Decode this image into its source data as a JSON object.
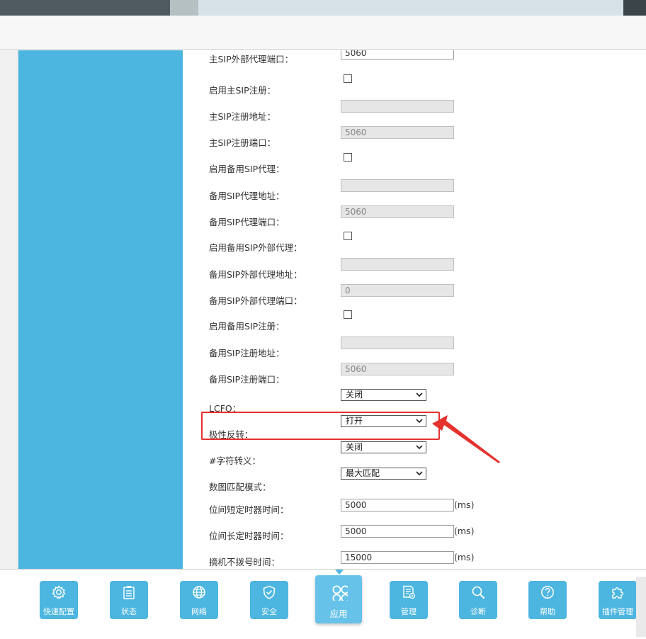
{
  "form": {
    "rows": [
      {
        "label": "主SIP外部代理端口：",
        "type": "input",
        "value": "5060"
      },
      {
        "label": "启用主SIP注册：",
        "type": "checkbox",
        "checked": false
      },
      {
        "label": "主SIP注册地址：",
        "type": "input-disabled",
        "value": ""
      },
      {
        "label": "主SIP注册端口：",
        "type": "input-disabled",
        "value": "5060"
      },
      {
        "label": "启用备用SIP代理：",
        "type": "checkbox",
        "checked": false
      },
      {
        "label": "备用SIP代理地址：",
        "type": "input-disabled",
        "value": ""
      },
      {
        "label": "备用SIP代理端口：",
        "type": "input-disabled",
        "value": "5060"
      },
      {
        "label": "启用备用SIP外部代理：",
        "type": "checkbox",
        "checked": false
      },
      {
        "label": "备用SIP外部代理地址：",
        "type": "input-disabled",
        "value": ""
      },
      {
        "label": "备用SIP外部代理端口：",
        "type": "input-disabled",
        "value": "0"
      },
      {
        "label": "启用备用SIP注册：",
        "type": "checkbox",
        "checked": false
      },
      {
        "label": "备用SIP注册地址：",
        "type": "input-disabled",
        "value": ""
      },
      {
        "label": "备用SIP注册端口：",
        "type": "input-disabled",
        "value": "5060"
      },
      {
        "label": "LCFO：",
        "type": "select",
        "value": "关闭"
      },
      {
        "label": "极性反转：",
        "type": "select",
        "value": "打开"
      },
      {
        "label": "#字符转义：",
        "type": "select",
        "value": "关闭"
      },
      {
        "label": "数图匹配模式：",
        "type": "select",
        "value": "最大匹配"
      },
      {
        "label": "位间短定时器时间：",
        "type": "input-unit",
        "value": "5000",
        "unit": "(ms)"
      },
      {
        "label": "位间长定时器时间：",
        "type": "input-unit",
        "value": "5000",
        "unit": "(ms)"
      },
      {
        "label": "摘机不拨号时间：",
        "type": "input-unit",
        "value": "15000",
        "unit": "(ms)"
      }
    ]
  },
  "nav": {
    "items": [
      {
        "label": "快速配置",
        "icon": "gear-icon"
      },
      {
        "label": "状态",
        "icon": "clipboard-icon"
      },
      {
        "label": "网络",
        "icon": "globe-icon"
      },
      {
        "label": "安全",
        "icon": "shield-icon"
      },
      {
        "label": "应用",
        "icon": "clover-icon",
        "active": true
      },
      {
        "label": "管理",
        "icon": "document-gear-icon"
      },
      {
        "label": "诊断",
        "icon": "magnifier-icon"
      },
      {
        "label": "帮助",
        "icon": "question-icon"
      },
      {
        "label": "插件管理",
        "icon": "puzzle-icon"
      }
    ]
  },
  "colors": {
    "sidebar": "#4db6e0",
    "highlight": "#e4322e",
    "nav_button": "#4db6e0"
  }
}
